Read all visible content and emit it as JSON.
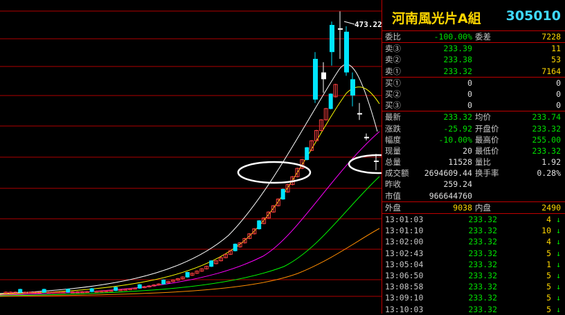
{
  "chart_data": {
    "type": "candlestick",
    "annotations": {
      "high_label": "473.22"
    },
    "colors": {
      "up": "#ff4040",
      "down": "#00e5ff",
      "ma": [
        "#ffffff",
        "#ffff00",
        "#ff00ff",
        "#00ff00",
        "#ff8c00"
      ]
    }
  },
  "stock": {
    "name": "河南風光片A組",
    "code": "305010"
  },
  "order_book": {
    "summary": [
      {
        "label": "委比",
        "value": "-100.00%",
        "label2": "委差",
        "value2": "7228"
      }
    ],
    "sell": [
      {
        "label": "卖③",
        "price": "233.39",
        "vol": "11"
      },
      {
        "label": "卖②",
        "price": "233.38",
        "vol": "53"
      },
      {
        "label": "卖①",
        "price": "233.32",
        "vol": "7164"
      }
    ],
    "buy": [
      {
        "label": "买①",
        "price": "0",
        "vol": "0"
      },
      {
        "label": "买②",
        "price": "0",
        "vol": "0"
      },
      {
        "label": "买③",
        "price": "0",
        "vol": "0"
      }
    ]
  },
  "quote": [
    {
      "l1": "最新",
      "v1": "233.32",
      "l2": "均价",
      "v2": "233.74"
    },
    {
      "l1": "涨跌",
      "v1": "-25.92",
      "l2": "开盘价",
      "v2": "233.32"
    },
    {
      "l1": "幅度",
      "v1": "-10.00%",
      "l2": "最高价",
      "v2": "255.00"
    },
    {
      "l1": "现量",
      "v1": "20",
      "l2": "最低价",
      "v2": "233.32"
    },
    {
      "l1": "总量",
      "v1": "11528",
      "l2": "量比",
      "v2": "1.92"
    },
    {
      "l1": "成交额",
      "v1": "2694609.44",
      "l2": "换手率",
      "v2": "0.28%"
    },
    {
      "l1": "昨收",
      "v1": "259.24",
      "l2": "",
      "v2": ""
    },
    {
      "l1": "市值",
      "v1": "966644760",
      "l2": "",
      "v2": ""
    }
  ],
  "outer_inner": {
    "l1": "外盘",
    "v1": "9038",
    "l2": "内盘",
    "v2": "2490"
  },
  "trades": [
    {
      "time": "13:01:03",
      "price": "233.32",
      "vol": "4",
      "dir": "↓"
    },
    {
      "time": "13:01:10",
      "price": "233.32",
      "vol": "10",
      "dir": "↓"
    },
    {
      "time": "13:02:00",
      "price": "233.32",
      "vol": "4",
      "dir": "↓"
    },
    {
      "time": "13:02:43",
      "price": "233.32",
      "vol": "5",
      "dir": "↓"
    },
    {
      "time": "13:05:04",
      "price": "233.32",
      "vol": "1",
      "dir": "↓"
    },
    {
      "time": "13:06:50",
      "price": "233.32",
      "vol": "5",
      "dir": "↓"
    },
    {
      "time": "13:08:58",
      "price": "233.32",
      "vol": "5",
      "dir": "↓"
    },
    {
      "time": "13:09:10",
      "price": "233.32",
      "vol": "5",
      "dir": "↓"
    },
    {
      "time": "13:10:03",
      "price": "233.32",
      "vol": "5",
      "dir": "↓"
    }
  ]
}
